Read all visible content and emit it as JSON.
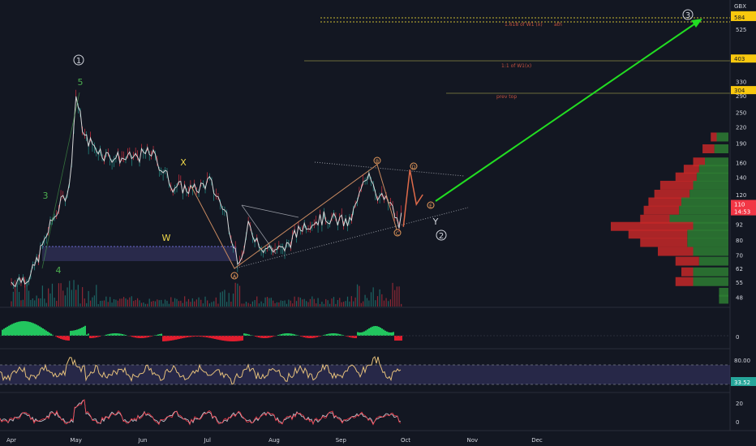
{
  "currency": "GBX",
  "x_ticks": [
    "Apr",
    "May",
    "Jun",
    "Jul",
    "Aug",
    "Sep",
    "Oct",
    "Nov",
    "Dec"
  ],
  "price_ticks": [
    "525",
    "330",
    "290",
    "250",
    "220",
    "190",
    "160",
    "140",
    "120",
    "92",
    "80",
    "70",
    "62",
    "55",
    "48"
  ],
  "price_badges": [
    {
      "text": "593",
      "color": "#f9c80e"
    },
    {
      "text": "584",
      "color": "#f9c80e"
    },
    {
      "text": "403",
      "color": "#f9c80e"
    },
    {
      "text": "304",
      "color": "#f9c80e"
    },
    {
      "text": "110",
      "color": "#f23645"
    },
    {
      "text": "14:53",
      "color": "#f23645"
    }
  ],
  "level_labels": [
    {
      "text": "1.618 of W1 (x)"
    },
    {
      "text": "ath"
    },
    {
      "text": "1:1 of W1(x)"
    },
    {
      "text": "prev top"
    }
  ],
  "wave_labels": [
    {
      "text": "1",
      "circled": true,
      "color": "#d1d4dc"
    },
    {
      "text": "5",
      "circled": false,
      "color": "#4caf50"
    },
    {
      "text": "3",
      "circled": false,
      "color": "#4caf50"
    },
    {
      "text": "4",
      "circled": false,
      "color": "#4caf50"
    },
    {
      "text": "X",
      "circled": false,
      "color": "#f0d84a"
    },
    {
      "text": "W",
      "circled": false,
      "color": "#f0d84a"
    },
    {
      "text": "Y",
      "circled": false,
      "color": "#d1d4dc"
    },
    {
      "text": "2",
      "circled": true,
      "color": "#d1d4dc"
    },
    {
      "text": "3",
      "circled": true,
      "color": "#d1d4dc"
    },
    {
      "text": "A",
      "circled": true,
      "color": "#e69a5c"
    },
    {
      "text": "B",
      "circled": true,
      "color": "#e69a5c"
    },
    {
      "text": "C",
      "circled": true,
      "color": "#e69a5c"
    },
    {
      "text": "D",
      "circled": true,
      "color": "#e69a5c"
    },
    {
      "text": "E",
      "circled": true,
      "color": "#e69a5c"
    }
  ],
  "macd_ticks": [
    "0"
  ],
  "rsi_ticks": [
    "80.00"
  ],
  "rsi_badge": "33.52",
  "stoch_ticks": [
    "20",
    "0"
  ],
  "colors": {
    "up": "#26a69a",
    "down": "#f23645",
    "price": "#d8d8d8",
    "arrow": "#22dd22",
    "wave": "#e69a5c"
  },
  "chart_data": {
    "type": "line",
    "title": "",
    "y_axis_unit": "GBX",
    "y_scale": "log",
    "ylim": [
      45,
      620
    ],
    "series": [
      {
        "x": [
          "2020-04-01",
          "2020-04-10",
          "2020-04-20",
          "2020-04-28",
          "2020-05-01",
          "2020-05-05",
          "2020-05-15",
          "2020-05-25",
          "2020-06-05",
          "2020-06-15",
          "2020-06-25",
          "2020-07-02",
          "2020-07-10",
          "2020-07-16",
          "2020-07-20",
          "2020-07-27",
          "2020-08-05",
          "2020-08-15",
          "2020-08-25",
          "2020-09-05",
          "2020-09-14",
          "2020-09-18",
          "2020-09-24",
          "2020-09-28",
          "2020-09-30"
        ],
        "y": [
          55,
          58,
          95,
          130,
          290,
          200,
          170,
          165,
          175,
          130,
          125,
          135,
          100,
          62,
          90,
          75,
          73,
          92,
          98,
          93,
          150,
          120,
          110,
          90,
          110
        ]
      }
    ],
    "projection": {
      "x": [
        "2020-09-30",
        "2020-10-03",
        "2020-10-06",
        "2020-10-09"
      ],
      "y": [
        90,
        150,
        110,
        120
      ]
    },
    "target_arrow": {
      "x": [
        "2020-10-09",
        "2020-12-31"
      ],
      "y": [
        120,
        584
      ]
    },
    "levels": [
      {
        "label": "1.618 of W1 (x)",
        "y": 593
      },
      {
        "label": "ath",
        "y": 584
      },
      {
        "label": "1:1 of W1(x)",
        "y": 403
      },
      {
        "label": "prev top",
        "y": 304
      }
    ],
    "volume_profile": [
      {
        "price": 200,
        "buy": 0.1,
        "sell": 0.05
      },
      {
        "price": 180,
        "buy": 0.12,
        "sell": 0.1
      },
      {
        "price": 160,
        "buy": 0.2,
        "sell": 0.1
      },
      {
        "price": 150,
        "buy": 0.25,
        "sell": 0.13
      },
      {
        "price": 140,
        "buy": 0.27,
        "sell": 0.18
      },
      {
        "price": 130,
        "buy": 0.3,
        "sell": 0.28
      },
      {
        "price": 120,
        "buy": 0.33,
        "sell": 0.3
      },
      {
        "price": 112,
        "buy": 0.4,
        "sell": 0.28
      },
      {
        "price": 104,
        "buy": 0.42,
        "sell": 0.3
      },
      {
        "price": 96,
        "buy": 0.5,
        "sell": 0.25
      },
      {
        "price": 90,
        "buy": 0.3,
        "sell": 0.7
      },
      {
        "price": 84,
        "buy": 0.35,
        "sell": 0.5
      },
      {
        "price": 78,
        "buy": 0.35,
        "sell": 0.4
      },
      {
        "price": 72,
        "buy": 0.3,
        "sell": 0.3
      },
      {
        "price": 66,
        "buy": 0.25,
        "sell": 0.2
      },
      {
        "price": 60,
        "buy": 0.3,
        "sell": 0.1
      },
      {
        "price": 55,
        "buy": 0.3,
        "sell": 0.15
      },
      {
        "price": 50,
        "buy": 0.08,
        "sell": 0.0
      },
      {
        "price": 47,
        "buy": 0.08,
        "sell": 0.0
      }
    ]
  }
}
